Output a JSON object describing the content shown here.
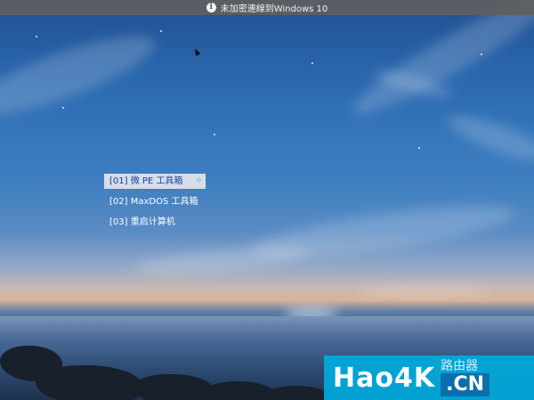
{
  "notification": {
    "icon": "info-icon",
    "icon_glyph": "i",
    "text": "未加密連線到Windows 10"
  },
  "boot_menu": {
    "items": [
      {
        "label": "[01] 微 PE 工具箱",
        "selected": true
      },
      {
        "label": "[02] MaxDOS 工具箱",
        "selected": false
      },
      {
        "label": "[03] 重启计算机",
        "selected": false
      }
    ],
    "selected_bg": "#d6ddeb",
    "selected_fg": "#1f3d99",
    "busy_icon_glyph": "⁘"
  },
  "watermark": {
    "main": "Hao4K",
    "cn_label": "路由器",
    "cn": ".CN",
    "color": "#00aadc"
  }
}
